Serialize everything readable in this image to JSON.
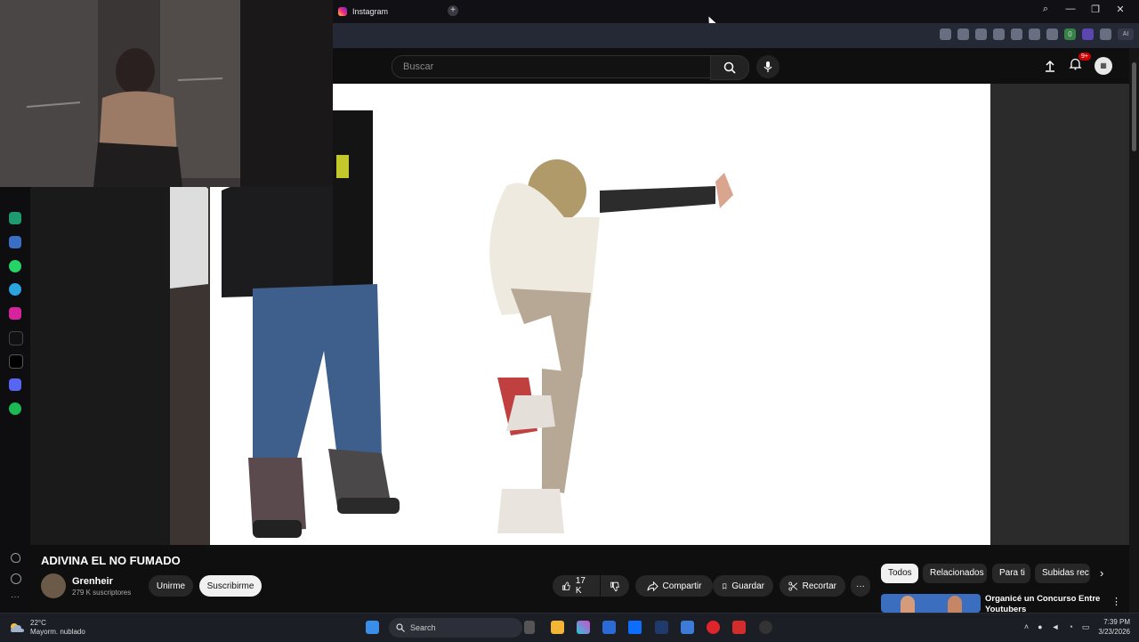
{
  "browser": {
    "tab_title": "Instagram",
    "new_tab": "+",
    "window_controls": [
      "⌕",
      "—",
      "❐",
      "✕"
    ],
    "badge_count": "0",
    "ai_label": "AI"
  },
  "youtube": {
    "search_placeholder": "Buscar",
    "notifications_badge": "9+"
  },
  "video": {
    "title": "ADIVINA EL NO FUMADO",
    "channel_name": "Grenheir",
    "subscribers": "279 K suscriptores",
    "join_label": "Unirme",
    "subscribe_label": "Suscribirme",
    "likes": "17 K",
    "share_label": "Compartir",
    "save_label": "Guardar",
    "clip_label": "Recortar",
    "more_label": "···"
  },
  "chips": {
    "all": "Todos",
    "related": "Relacionados",
    "for_you": "Para ti",
    "uploads": "Subidas rec"
  },
  "recommendation": {
    "title": "Organicé un Concurso Entre Youtubers"
  },
  "taskbar": {
    "temperature": "22°C",
    "weather": "Mayorm. nublado",
    "search_label": "Search",
    "time": "7:39 PM",
    "date": "3/23/2026"
  }
}
